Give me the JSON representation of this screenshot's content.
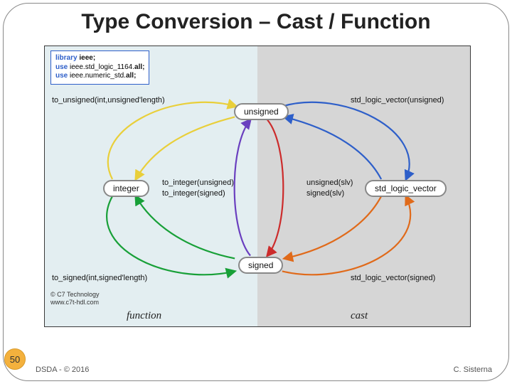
{
  "title": "Type Conversion – Cast / Function",
  "library": {
    "kw_library": "library",
    "lib_ieee": "ieee;",
    "kw_use1": "use",
    "pkg1_pre": "ieee.std_logic_1164.",
    "pkg1_all": "all;",
    "kw_use2": "use",
    "pkg2_pre": "ieee.numeric_std.",
    "pkg2_all": "all;"
  },
  "nodes": {
    "unsigned": "unsigned",
    "integer": "integer",
    "signed": "signed",
    "slv": "std_logic_vector"
  },
  "labels": {
    "to_unsigned": "to_unsigned(int,unsigned'length)",
    "slv_unsigned": "std_logic_vector(unsigned)",
    "to_integer_unsigned": "to_integer(unsigned)",
    "to_integer_signed": "to_integer(signed)",
    "unsigned_slv": "unsigned(slv)",
    "signed_slv": "signed(slv)",
    "to_signed": "to_signed(int,signed'length)",
    "slv_signed": "std_logic_vector(signed)"
  },
  "halves": {
    "left": "function",
    "right": "cast"
  },
  "copyright": {
    "line1": "© C7 Technology",
    "line2": "www.c7t-hdl.com"
  },
  "page": "50",
  "footer": {
    "left": "DSDA - © 2016",
    "right": "C. Sisterna"
  },
  "colors": {
    "yellow": "#e9cf3a",
    "blue": "#2e5fc9",
    "green": "#18a038",
    "orange": "#e06a1a",
    "purple": "#6a3fbf",
    "red": "#cc2b2b"
  }
}
